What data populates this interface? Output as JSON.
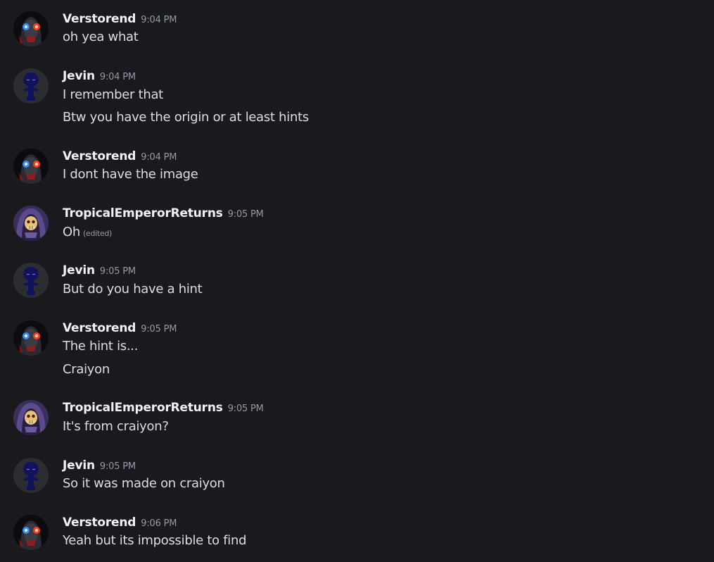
{
  "colors": {
    "background": "#1a1a1e",
    "username": "#f2f3f5",
    "message_text": "#dbdee1",
    "timestamp": "#949ba4"
  },
  "messages": [
    {
      "author": "Verstorend",
      "avatar": "skull-robot-avatar",
      "time": "9:04 PM",
      "lines": [
        "oh yea what"
      ]
    },
    {
      "author": "Jevin",
      "avatar": "blue-figure-avatar",
      "time": "9:04 PM",
      "lines": [
        "I remember that",
        "Btw you have the origin or at least hints"
      ]
    },
    {
      "author": "Verstorend",
      "avatar": "skull-robot-avatar",
      "time": "9:04 PM",
      "lines": [
        "I dont have the image"
      ]
    },
    {
      "author": "TropicalEmperorReturns",
      "avatar": "hooded-skeleton-avatar",
      "time": "9:05 PM",
      "lines": [
        "Oh"
      ],
      "edited_label": "(edited)"
    },
    {
      "author": "Jevin",
      "avatar": "blue-figure-avatar",
      "time": "9:05 PM",
      "lines": [
        "But do you have a hint"
      ]
    },
    {
      "author": "Verstorend",
      "avatar": "skull-robot-avatar",
      "time": "9:05 PM",
      "lines": [
        "The hint is...",
        "Craiyon"
      ]
    },
    {
      "author": "TropicalEmperorReturns",
      "avatar": "hooded-skeleton-avatar",
      "time": "9:05 PM",
      "lines": [
        "It's from craiyon?"
      ]
    },
    {
      "author": "Jevin",
      "avatar": "blue-figure-avatar",
      "time": "9:05 PM",
      "lines": [
        "So it was made on craiyon"
      ]
    },
    {
      "author": "Verstorend",
      "avatar": "skull-robot-avatar",
      "time": "9:06 PM",
      "lines": [
        "Yeah but its impossible to find"
      ]
    }
  ]
}
